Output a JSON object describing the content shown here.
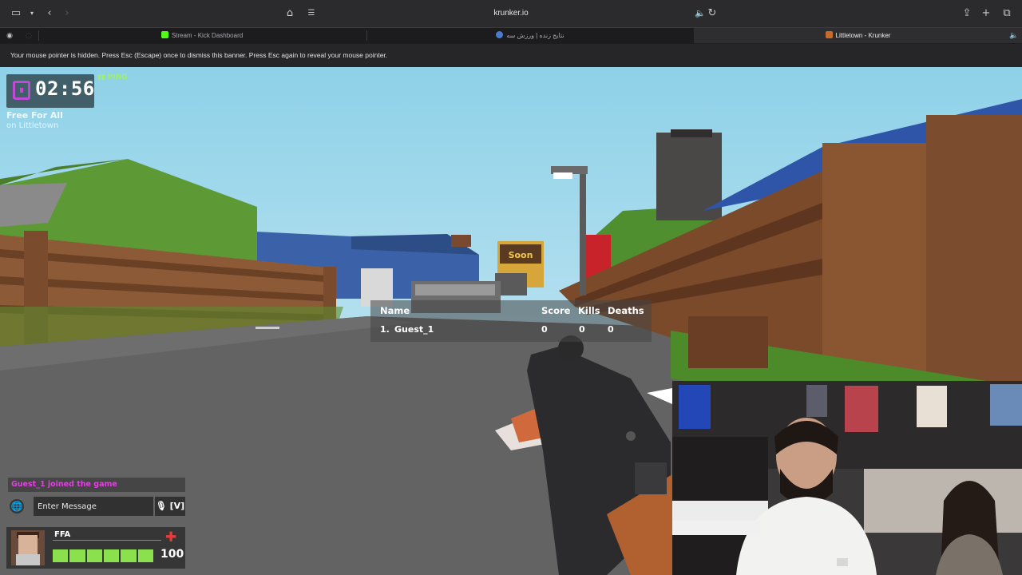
{
  "browser": {
    "url": "krunker.io",
    "tabs": [
      {
        "title": "Stream - Kick Dashboard",
        "active": false,
        "favicon_color": "#53fc18"
      },
      {
        "title": "نتایج زنده | ورزش سه",
        "active": false,
        "favicon_color": "#4a7bd0"
      },
      {
        "title": "Littletown - Krunker",
        "active": true,
        "favicon_color": "#c86a2a"
      }
    ],
    "banner": "Your mouse pointer is hidden. Press Esc (Escape) once to dismiss this banner. Press Esc again to reveal your mouse pointer."
  },
  "hud": {
    "timer": "02:56",
    "ping_label": "PING",
    "mode": "Free For All",
    "map": "on Littletown"
  },
  "scoreboard": {
    "headers": {
      "name": "Name",
      "score": "Score",
      "kills": "Kills",
      "deaths": "Deaths"
    },
    "rows": [
      {
        "rank": "1.",
        "name": "Guest_1",
        "score": "0",
        "kills": "0",
        "deaths": "0"
      }
    ]
  },
  "chat": {
    "message": "Guest_1 joined the game",
    "placeholder": "Enter Message",
    "voice_key": "[V]"
  },
  "player": {
    "class": "FFA",
    "health": "100",
    "health_segments": 6,
    "health_fraction": 1.0
  },
  "sign_text": "Soon",
  "colors": {
    "chat_message": "#e040e0",
    "health_bar": "#8be04e",
    "timer_icon": "#c04ad6"
  }
}
